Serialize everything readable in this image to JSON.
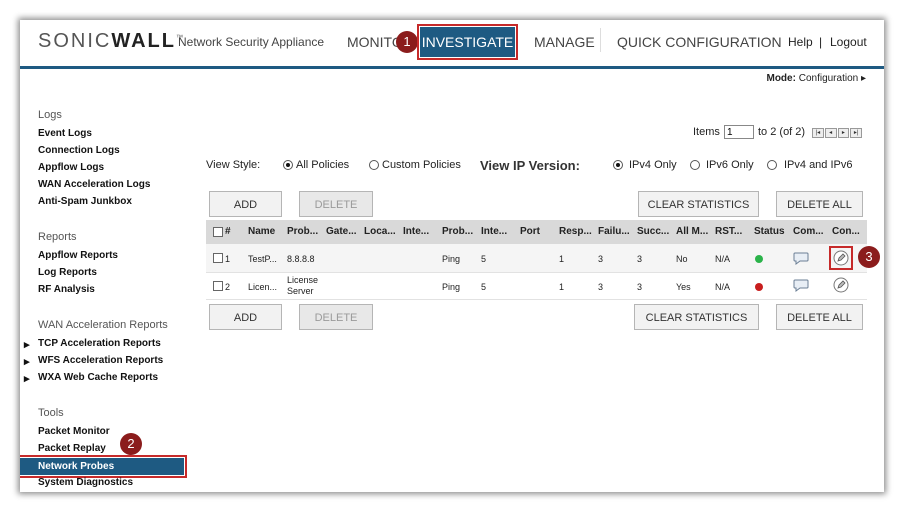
{
  "header": {
    "logo_left": "SONIC",
    "logo_bold": "WALL",
    "logo_tm": "™",
    "product": "Network Security Appliance",
    "nav": {
      "monitor": "MONITO",
      "investigate": "INVESTIGATE",
      "manage": "MANAGE",
      "quick_config": "QUICK CONFIGURATION"
    },
    "help": "Help",
    "separator": "|",
    "logout": "Logout"
  },
  "mode": {
    "label": "Mode:",
    "value": "Configuration ▸"
  },
  "sidebar": {
    "logs": {
      "title": "Logs",
      "items": [
        "Event Logs",
        "Connection Logs",
        "Appflow Logs",
        "WAN Acceleration Logs",
        "Anti-Spam Junkbox"
      ]
    },
    "reports": {
      "title": "Reports",
      "items": [
        "Appflow Reports",
        "Log Reports",
        "RF Analysis"
      ]
    },
    "wan": {
      "title": "WAN Acceleration Reports",
      "items": [
        "TCP Acceleration Reports",
        "WFS Acceleration Reports",
        "WXA Web Cache Reports"
      ]
    },
    "tools": {
      "title": "Tools",
      "items": [
        "Packet Monitor",
        "Packet Replay",
        "Network Probes",
        "System Diagnostics"
      ]
    }
  },
  "callouts": [
    "1",
    "2",
    "3"
  ],
  "pager": {
    "label": "Items",
    "value": "1",
    "range": "to 2 (of 2)",
    "first": "|◂",
    "prev": "◂",
    "next": "▸",
    "last": "▸|"
  },
  "view_style": {
    "label": "View Style:",
    "all": "All Policies",
    "custom": "Custom Policies",
    "selected": "All Policies"
  },
  "view_ip": {
    "label": "View IP Version:",
    "ipv4": "IPv4 Only",
    "ipv6": "IPv6 Only",
    "both": "IPv4 and IPv6",
    "selected": "IPv4 Only"
  },
  "buttons": {
    "add": "ADD",
    "delete": "DELETE",
    "clear_stats": "CLEAR STATISTICS",
    "delete_all": "DELETE ALL"
  },
  "table": {
    "headers": [
      "#",
      "Name",
      "Prob...",
      "Gate...",
      "Loca...",
      "Inte...",
      "Prob...",
      "Inte...",
      "Port",
      "Resp...",
      "Failu...",
      "Succ...",
      "All M...",
      "RST...",
      "Status",
      "Com...",
      "Con..."
    ],
    "rows": [
      {
        "num": "1",
        "name": "TestP...",
        "probe_target": "8.8.8.8",
        "probe_type": "Ping",
        "interval": "5",
        "response": "1",
        "failure": "3",
        "success": "3",
        "all_match": "No",
        "rst": "N/A",
        "status_color": "#2bb34a"
      },
      {
        "num": "2",
        "name": "Licen...",
        "probe_target": "License Server",
        "probe_type": "Ping",
        "interval": "5",
        "response": "1",
        "failure": "3",
        "success": "3",
        "all_match": "Yes",
        "rst": "N/A",
        "status_color": "#c81e1e"
      }
    ]
  },
  "colors": {
    "brand": "#1e5a82",
    "highlight": "#c62a2a",
    "callout": "#8b1c1c"
  }
}
